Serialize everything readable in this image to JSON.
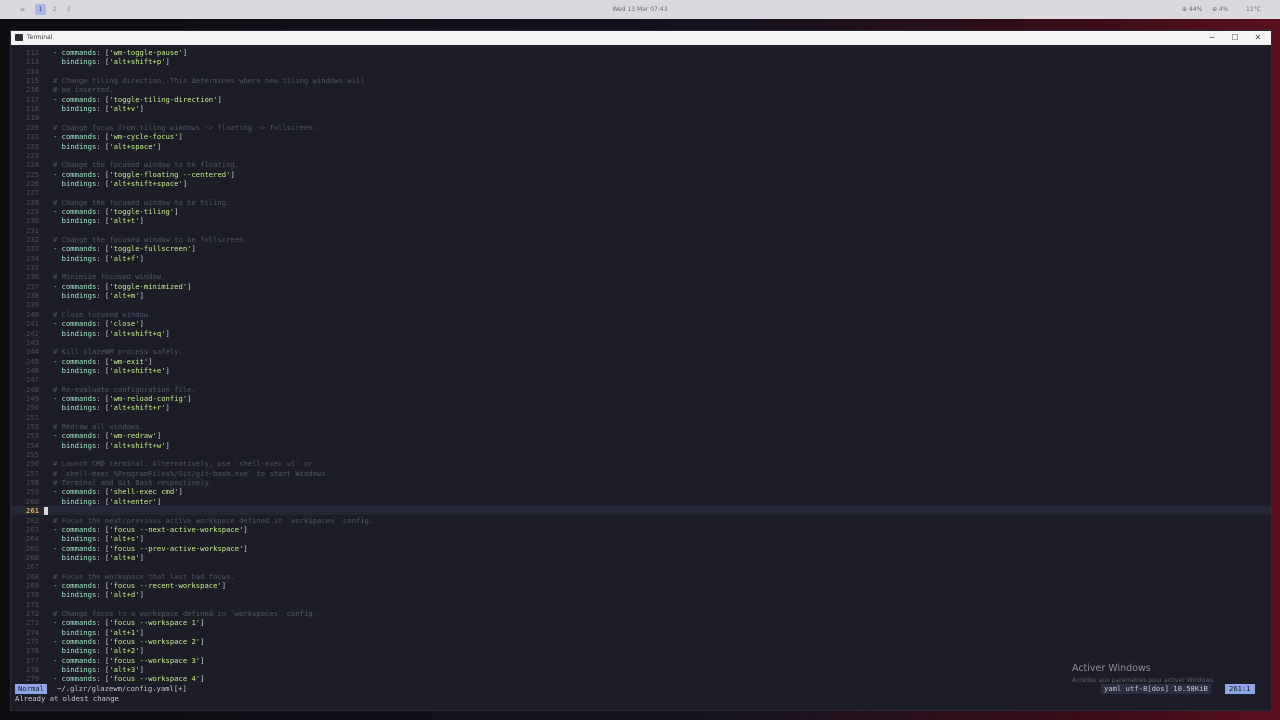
{
  "topbar": {
    "workspaces": [
      "≡",
      "1",
      "2",
      "3"
    ],
    "clock": "Wed 13 Mar 07:43",
    "stats": [
      "⊕ 44%",
      "⊕ 4%",
      "11°C"
    ]
  },
  "window": {
    "title": "Terminal",
    "controls": [
      "─",
      "☐",
      "✕"
    ]
  },
  "editor": {
    "lines": [
      {
        "n": "212",
        "t": "- commands: ['wm-toggle-pause']"
      },
      {
        "n": "213",
        "t": "  bindings: ['alt+shift+p']"
      },
      {
        "n": "214",
        "t": ""
      },
      {
        "n": "215",
        "t": "# Change tiling direction. This determines where new tiling windows will"
      },
      {
        "n": "216",
        "t": "# be inserted."
      },
      {
        "n": "217",
        "t": "- commands: ['toggle-tiling-direction']"
      },
      {
        "n": "218",
        "t": "  bindings: ['alt+v']"
      },
      {
        "n": "219",
        "t": ""
      },
      {
        "n": "220",
        "t": "# Change focus from tiling windows -> floating -> fullscreen."
      },
      {
        "n": "221",
        "t": "- commands: ['wm-cycle-focus']"
      },
      {
        "n": "222",
        "t": "  bindings: ['alt+space']"
      },
      {
        "n": "223",
        "t": ""
      },
      {
        "n": "224",
        "t": "# Change the focused window to be floating."
      },
      {
        "n": "225",
        "t": "- commands: ['toggle-floating --centered']"
      },
      {
        "n": "226",
        "t": "  bindings: ['alt+shift+space']"
      },
      {
        "n": "227",
        "t": ""
      },
      {
        "n": "228",
        "t": "# Change the focused window to be tiling."
      },
      {
        "n": "229",
        "t": "- commands: ['toggle-tiling']"
      },
      {
        "n": "230",
        "t": "  bindings: ['alt+t']"
      },
      {
        "n": "231",
        "t": ""
      },
      {
        "n": "232",
        "t": "# Change the focused window to be fullscreen."
      },
      {
        "n": "233",
        "t": "- commands: ['toggle-fullscreen']"
      },
      {
        "n": "234",
        "t": "  bindings: ['alt+f']"
      },
      {
        "n": "235",
        "t": ""
      },
      {
        "n": "236",
        "t": "# Minimize focused window."
      },
      {
        "n": "237",
        "t": "- commands: ['toggle-minimized']"
      },
      {
        "n": "238",
        "t": "  bindings: ['alt+m']"
      },
      {
        "n": "239",
        "t": ""
      },
      {
        "n": "240",
        "t": "# Close focused window."
      },
      {
        "n": "241",
        "t": "- commands: ['close']"
      },
      {
        "n": "242",
        "t": "  bindings: ['alt+shift+q']"
      },
      {
        "n": "243",
        "t": ""
      },
      {
        "n": "244",
        "t": "# Kill GlazeWM process safely."
      },
      {
        "n": "245",
        "t": "- commands: ['wm-exit']"
      },
      {
        "n": "246",
        "t": "  bindings: ['alt+shift+e']"
      },
      {
        "n": "247",
        "t": ""
      },
      {
        "n": "248",
        "t": "# Re-evaluate configuration file."
      },
      {
        "n": "249",
        "t": "- commands: ['wm-reload-config']"
      },
      {
        "n": "250",
        "t": "  bindings: ['alt+shift+r']"
      },
      {
        "n": "251",
        "t": ""
      },
      {
        "n": "252",
        "t": "# Redraw all windows."
      },
      {
        "n": "253",
        "t": "- commands: ['wm-redraw']"
      },
      {
        "n": "254",
        "t": "  bindings: ['alt+shift+w']"
      },
      {
        "n": "255",
        "t": ""
      },
      {
        "n": "256",
        "t": "# Launch CMD terminal. Alternatively, use `shell-exec wt` or"
      },
      {
        "n": "257",
        "t": "# `shell-exec %ProgramFiles%/Git/git-bash.exe` to start Windows"
      },
      {
        "n": "258",
        "t": "# Terminal and Git Bash respectively."
      },
      {
        "n": "259",
        "t": "- commands: ['shell-exec cmd']"
      },
      {
        "n": "260",
        "t": "  bindings: ['alt+enter']"
      },
      {
        "n": "261",
        "t": ""
      },
      {
        "n": "262",
        "t": "# Focus the next/previous active workspace defined in `workspaces` config."
      },
      {
        "n": "263",
        "t": "- commands: ['focus --next-active-workspace']"
      },
      {
        "n": "264",
        "t": "  bindings: ['alt+s']"
      },
      {
        "n": "265",
        "t": "- commands: ['focus --prev-active-workspace']"
      },
      {
        "n": "266",
        "t": "  bindings: ['alt+a']"
      },
      {
        "n": "267",
        "t": ""
      },
      {
        "n": "268",
        "t": "# Focus the workspace that last had focus."
      },
      {
        "n": "269",
        "t": "- commands: ['focus --recent-workspace']"
      },
      {
        "n": "270",
        "t": "  bindings: ['alt+d']"
      },
      {
        "n": "271",
        "t": ""
      },
      {
        "n": "272",
        "t": "# Change focus to a workspace defined in `workspaces` config."
      },
      {
        "n": "273",
        "t": "- commands: ['focus --workspace 1']"
      },
      {
        "n": "274",
        "t": "  bindings: ['alt+1']"
      },
      {
        "n": "275",
        "t": "- commands: ['focus --workspace 2']"
      },
      {
        "n": "276",
        "t": "  bindings: ['alt+2']"
      },
      {
        "n": "277",
        "t": "- commands: ['focus --workspace 3']"
      },
      {
        "n": "278",
        "t": "  bindings: ['alt+3']"
      },
      {
        "n": "279",
        "t": "- commands: ['focus --workspace 4']"
      }
    ],
    "current_line": "261"
  },
  "statusline": {
    "mode": "Normal",
    "file": "~/.glzr/glazewm/config.yaml[+]",
    "fileinfo": "yaml utf-8[dos] 10.58KiB",
    "position": "261:1"
  },
  "message": "Already at oldest change",
  "watermark": {
    "title": "Activer Windows",
    "subtitle": "Accédez aux paramètres pour activer Windows."
  }
}
